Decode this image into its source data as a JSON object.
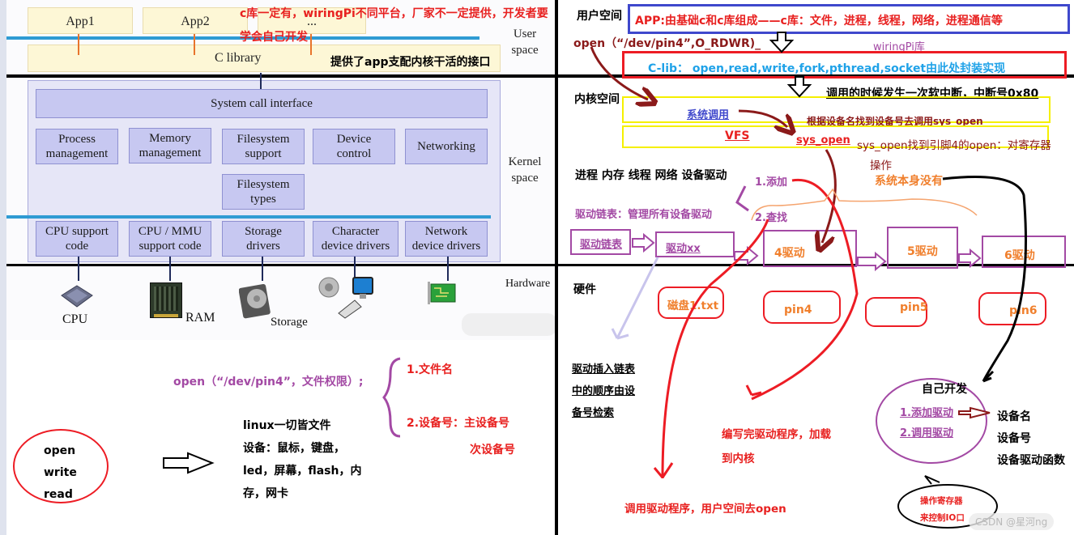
{
  "left": {
    "apps": [
      "App1",
      "App2",
      "..."
    ],
    "c_library": "C library",
    "user_space_label": [
      "User",
      "space"
    ],
    "kernel_space_label": [
      "Kernel",
      "space"
    ],
    "hardware_label": "Hardware",
    "syscall_interface": "System call interface",
    "subsystems": [
      [
        "Process",
        "management"
      ],
      [
        "Memory",
        "management"
      ],
      [
        "Filesystem",
        "support"
      ],
      [
        "Device",
        "control"
      ],
      [
        "Networking",
        ""
      ]
    ],
    "fs_types": [
      "Filesystem",
      "types"
    ],
    "drivers": [
      [
        "CPU support",
        "code"
      ],
      [
        "CPU / MMU",
        "support code"
      ],
      [
        "Storage",
        "drivers"
      ],
      [
        "Character",
        "device drivers"
      ],
      [
        "Network",
        "device drivers"
      ]
    ],
    "hardware_items": [
      {
        "label": "CPU",
        "icon": "cpu-chip-icon"
      },
      {
        "label": "RAM",
        "icon": "ram-module-icon"
      },
      {
        "label": "Storage",
        "icon": "hard-disk-icon"
      },
      {
        "label": "",
        "icon": "peripherals-icon"
      },
      {
        "label": "",
        "icon": "network-card-icon"
      }
    ],
    "annotation_clib_red_1": "c库一定有，wiringPi不同平台，厂家不一定提供，开发者要",
    "annotation_clib_red_2": "学会自己开发",
    "annotation_clib_black": "提供了app支配内核干活的接口"
  },
  "bottom_left": {
    "open_call": "open（“/dev/pin4”，文件权限）;",
    "brace_items": [
      "1.文件名",
      "2.设备号：主设备号",
      "次设备号"
    ],
    "circle_items": [
      "open",
      "write",
      "read"
    ],
    "everything_file": [
      "linux一切皆文件",
      "设备：鼠标，键盘，",
      "led，屏幕，flash，内",
      "存，网卡"
    ]
  },
  "right": {
    "user_space_title": "用户空间",
    "app_desc": "APP:由基础c和c库组成——c库：文件，进程，线程，网络，进程通信等",
    "open_call": "open（“/dev/pin4”,O_RDWR)_",
    "wiringpi_label": "wiringPi库",
    "clib_desc": "C-lib： open,read,write,fork,pthread,socket由此处封装实现",
    "kernel_space_title": "内核空间",
    "soft_interrupt": "调用的时候发生一次软中断，中断号0x80",
    "syscall": "系统调用",
    "find_by_name": "根据设备名找到设备号去调用sys_open",
    "vfs": "VFS",
    "sys_open": "sys_open",
    "sys_open_desc_1": "sys_open找到引脚4的open：对寄存器",
    "sys_open_desc_2": "操作",
    "kernel_parts": "进程 内存 线程 网络 设备驱动",
    "step_add": "1.添加",
    "step_find": "2.查找",
    "driver_list_desc": "驱动链表：管理所有设备驱动",
    "not_in_system": "系统本身没有",
    "chain": [
      "驱动链表",
      "驱动xx",
      "4驱动",
      "5驱动",
      "6驱动"
    ],
    "hardware_title": "硬件",
    "hardware_items": [
      "磁盘1.txt",
      "pin4",
      "pin5",
      "pin6"
    ],
    "insert_order": [
      "驱动插入链表",
      "中的顺序由设",
      "备号检索"
    ],
    "write_driver": [
      "编写完驱动程序，加载",
      "到内核"
    ],
    "call_driver": "调用驱动程序，用户空间去open",
    "self_dev_title": "自己开发",
    "self_dev_items": [
      "1.添加驱动",
      "2.调用驱动"
    ],
    "device_props": [
      "设备名",
      "设备号",
      "设备驱动函数"
    ],
    "bubble": [
      "操作寄存器",
      "来控制IO口"
    ],
    "watermark": "CSDN @星河ng"
  }
}
